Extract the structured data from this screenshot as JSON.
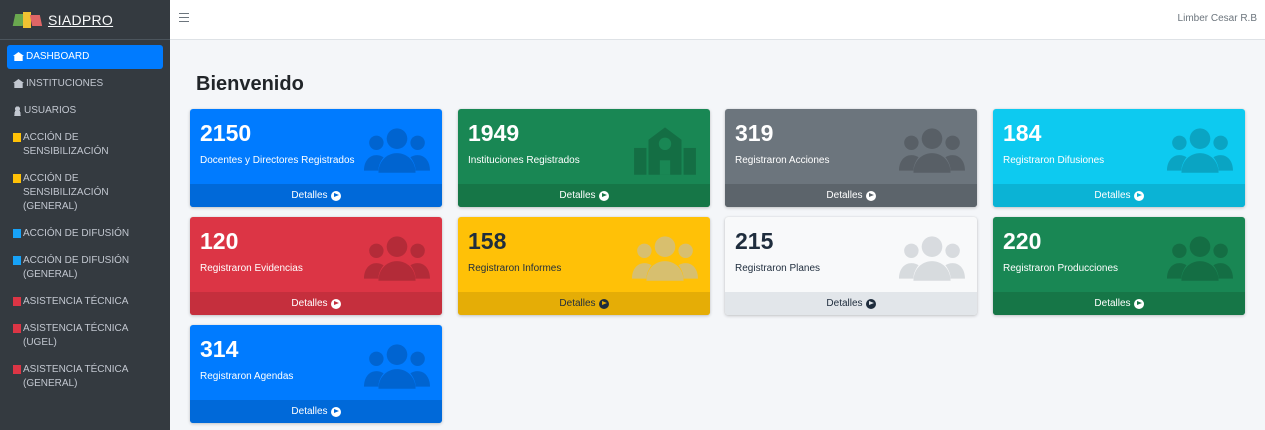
{
  "brand": {
    "name": "SIADPRO"
  },
  "topbar": {
    "user_name": "Limber Cesar R.B",
    "menu_icon": "hamburger-icon"
  },
  "sidebar": {
    "items": [
      {
        "label": "DASHBOARD",
        "icon": "home-icon",
        "active": true
      },
      {
        "label": "INSTITUCIONES",
        "icon": "home-icon",
        "active": false
      },
      {
        "label": "USUARIOS",
        "icon": "user-icon",
        "active": false
      },
      {
        "label": "ACCIÓN DE SENSIBILIZACIÓN",
        "icon": "square-yellow-icon",
        "active": false
      },
      {
        "label": "ACCIÓN DE SENSIBILIZACIÓN (GENERAL)",
        "icon": "square-yellow-icon",
        "active": false
      },
      {
        "label": "ACCIÓN DE DIFUSIÓN",
        "icon": "square-blue-icon",
        "active": false
      },
      {
        "label": "ACCIÓN DE DIFUSIÓN (GENERAL)",
        "icon": "square-blue-icon",
        "active": false
      },
      {
        "label": "ASISTENCIA TÉCNICA",
        "icon": "square-red-icon",
        "active": false
      },
      {
        "label": "ASISTENCIA TÉCNICA (UGEL)",
        "icon": "square-red-icon",
        "active": false
      },
      {
        "label": "ASISTENCIA TÉCNICA (GENERAL)",
        "icon": "square-red-icon",
        "active": false
      }
    ]
  },
  "main": {
    "title": "Bienvenido",
    "cards": [
      {
        "value": "2150",
        "label": "Docentes y Directores Registrados",
        "footer": "Detalles",
        "color": "#007bff",
        "icon": "users-icon"
      },
      {
        "value": "1949",
        "label": "Instituciones Registrados",
        "footer": "Detalles",
        "color": "#198754",
        "icon": "school-icon"
      },
      {
        "value": "319",
        "label": "Registraron Acciones",
        "footer": "Detalles",
        "color": "#6c757d",
        "icon": "users-icon"
      },
      {
        "value": "184",
        "label": "Registraron Difusiones",
        "footer": "Detalles",
        "color": "#0dcaf0",
        "icon": "users-icon"
      },
      {
        "value": "120",
        "label": "Registraron Evidencias",
        "footer": "Detalles",
        "color": "#dc3545",
        "icon": "users-icon"
      },
      {
        "value": "158",
        "label": "Registraron Informes",
        "footer": "Detalles",
        "color": "#ffc107",
        "icon": "users-icon"
      },
      {
        "value": "215",
        "label": "Registraron Planes",
        "footer": "Detalles",
        "color": "#f8f9fa",
        "icon": "users-icon"
      },
      {
        "value": "220",
        "label": "Registraron Producciones",
        "footer": "Detalles",
        "color": "#198754",
        "icon": "users-icon"
      },
      {
        "value": "314",
        "label": "Registraron Agendas",
        "footer": "Detalles",
        "color": "#007bff",
        "icon": "users-icon"
      }
    ]
  }
}
